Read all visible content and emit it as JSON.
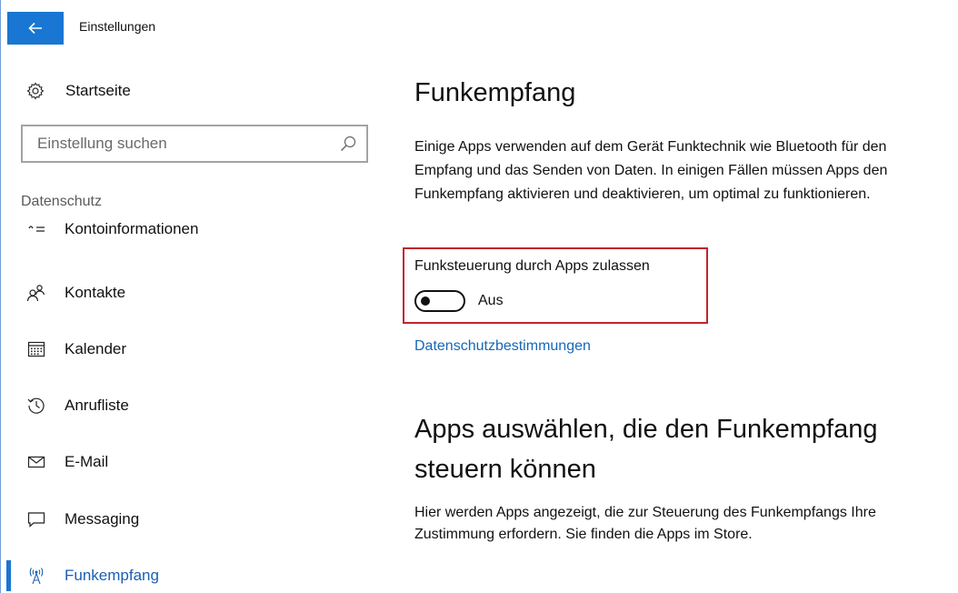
{
  "window": {
    "title": "Einstellungen",
    "accent_color": "#1976d2"
  },
  "sidebar": {
    "home_label": "Startseite",
    "search": {
      "placeholder": "Einstellung suchen",
      "value": ""
    },
    "group_label": "Datenschutz",
    "items": [
      {
        "label": "Kontoinformationen",
        "icon": "account-info-icon"
      },
      {
        "label": "Kontakte",
        "icon": "contacts-icon"
      },
      {
        "label": "Kalender",
        "icon": "calendar-icon"
      },
      {
        "label": "Anrufliste",
        "icon": "history-icon"
      },
      {
        "label": "E-Mail",
        "icon": "mail-icon"
      },
      {
        "label": "Messaging",
        "icon": "message-icon"
      },
      {
        "label": "Funkempfang",
        "icon": "radio-icon",
        "active": true
      }
    ]
  },
  "main": {
    "title": "Funkempfang",
    "description": "Einige Apps verwenden auf dem Gerät Funktechnik wie Bluetooth für den Empfang und das Senden von Daten. In einigen Fällen müssen Apps den Funkempfang aktivieren und deaktivieren, um optimal zu funktionieren.",
    "toggle": {
      "label": "Funksteuerung durch Apps zulassen",
      "state": "Aus",
      "on": false
    },
    "highlight_color": "#c0252e",
    "privacy_link": "Datenschutzbestimmungen",
    "section_title": "Apps auswählen, die den Funkempfang steuern können",
    "section_description": "Hier werden Apps angezeigt, die zur Steuerung des Funkempfangs Ihre Zustimmung erfordern. Sie finden die Apps im Store."
  }
}
